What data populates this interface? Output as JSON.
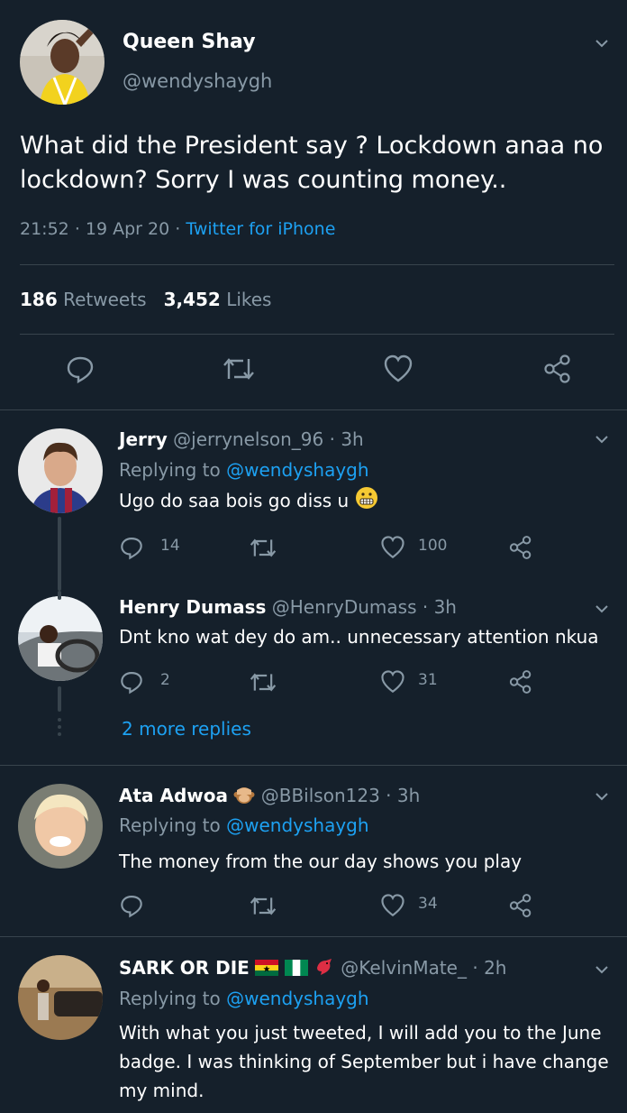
{
  "main_tweet": {
    "name": "Queen Shay",
    "handle": "@wendyshaygh",
    "text": "What did the President say ? Lockdown anaa no lockdown? Sorry I was counting money..",
    "time": "21:52",
    "date": "19 Apr 20",
    "source": "Twitter for iPhone",
    "retweets": "186",
    "retweets_label": "Retweets",
    "likes": "3,452",
    "likes_label": "Likes"
  },
  "replies": [
    {
      "name": "Jerry",
      "handle": "@jerrynelson_96",
      "age": "3h",
      "replying_label": "Replying to",
      "replying_to": "@wendyshaygh",
      "text": "Ugo do saa bois go diss u",
      "replies_count": "14",
      "retweets_count": "",
      "likes_count": "100"
    },
    {
      "name": "Henry Dumass",
      "handle": "@HenryDumass",
      "age": "3h",
      "text": "Dnt kno wat dey do am.. unnecessary attention nkua",
      "replies_count": "2",
      "retweets_count": "",
      "likes_count": "31"
    },
    {
      "name": "Ata Adwoa",
      "handle": "@BBilson123",
      "age": "3h",
      "replying_label": "Replying to",
      "replying_to": "@wendyshaygh",
      "text": "The money from the our day shows you play",
      "replies_count": "",
      "retweets_count": "",
      "likes_count": "34"
    },
    {
      "name": "SARK OR DIE",
      "handle": "@KelvinMate_",
      "age": "2h",
      "replying_label": "Replying to",
      "replying_to": "@wendyshaygh",
      "text": "With what you just tweeted, I will add you to the June badge. I was thinking of September but i have change my mind."
    }
  ],
  "more_replies": "2 more replies",
  "dot": "·",
  "colors": {
    "background": "#15202b",
    "muted": "#8899a6",
    "link": "#1da1f2",
    "divider": "#38444d"
  }
}
